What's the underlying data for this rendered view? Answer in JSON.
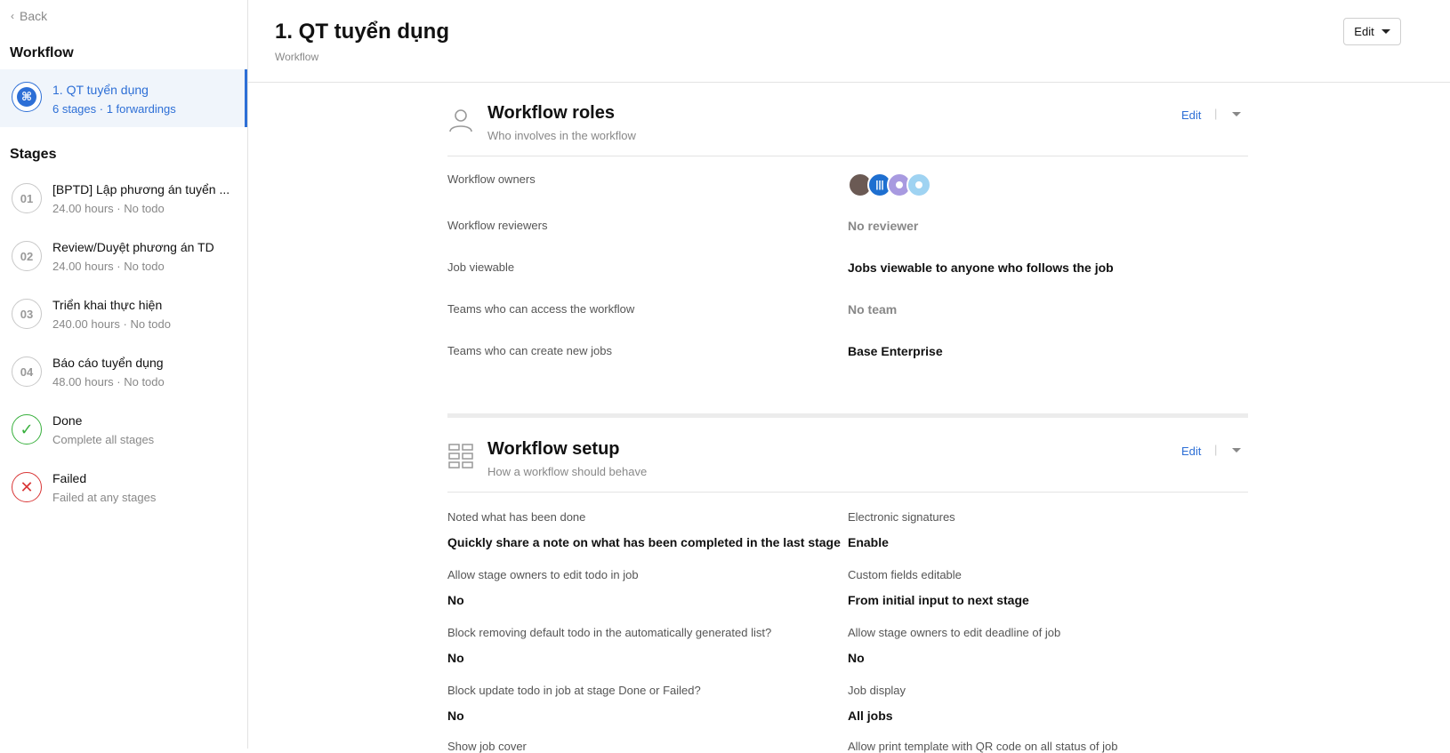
{
  "sidebar": {
    "back_label": "Back",
    "workflow_heading": "Workflow",
    "workflow": {
      "name": "1. QT tuyển dụng",
      "meta": "6 stages · 1 forwardings"
    },
    "stages_heading": "Stages",
    "stages": [
      {
        "num": "01",
        "name": "[BPTD] Lập phương án tuyển ...",
        "sub": "24.00 hours · No todo"
      },
      {
        "num": "02",
        "name": "Review/Duyệt phương án TD",
        "sub": "24.00 hours · No todo"
      },
      {
        "num": "03",
        "name": "Triển khai thực hiện",
        "sub": "240.00 hours · No todo"
      },
      {
        "num": "04",
        "name": "Báo cáo tuyển dụng",
        "sub": "48.00 hours · No todo"
      },
      {
        "num": "✓",
        "name": "Done",
        "sub": "Complete all stages"
      },
      {
        "num": "✕",
        "name": "Failed",
        "sub": "Failed at any stages"
      }
    ]
  },
  "header": {
    "title": "1. QT tuyển dụng",
    "subtitle": "Workflow",
    "edit_label": "Edit"
  },
  "roles": {
    "title": "Workflow roles",
    "subtitle": "Who involves in the workflow",
    "edit_label": "Edit",
    "separator": "|",
    "rows": [
      {
        "label": "Workflow owners",
        "value": ""
      },
      {
        "label": "Workflow reviewers",
        "value": "No reviewer"
      },
      {
        "label": "Job viewable",
        "value": "Jobs viewable to anyone who follows the job"
      },
      {
        "label": "Teams who can access the workflow",
        "value": "No team"
      },
      {
        "label": "Teams who can create new jobs",
        "value": "Base Enterprise"
      }
    ]
  },
  "setup": {
    "title": "Workflow setup",
    "subtitle": "How a workflow should behave",
    "edit_label": "Edit",
    "separator": "|",
    "items": [
      {
        "label": "Noted what has been done",
        "value": "Quickly share a note on what has been completed in the last stage"
      },
      {
        "label": "Electronic signatures",
        "value": "Enable"
      },
      {
        "label": "Allow stage owners to edit todo in job",
        "value": "No"
      },
      {
        "label": "Custom fields editable",
        "value": "From initial input to next stage"
      },
      {
        "label": "Block removing default todo in the automatically generated list?",
        "value": "No"
      },
      {
        "label": "Allow stage owners to edit deadline of job",
        "value": "No"
      },
      {
        "label": "Block update todo in job at stage Done or Failed?",
        "value": "No"
      },
      {
        "label": "Job display",
        "value": "All jobs"
      },
      {
        "label": "Show job cover",
        "value": ""
      },
      {
        "label": "Allow print template with QR code on all status of job",
        "value": ""
      }
    ]
  }
}
